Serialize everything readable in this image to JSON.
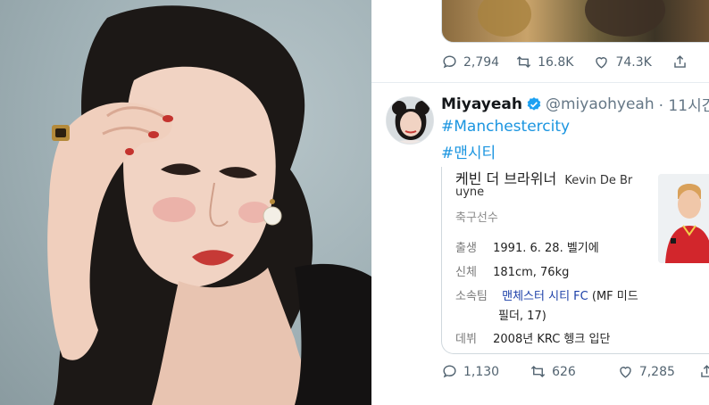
{
  "previous_tweet": {
    "replies": "2,794",
    "retweets": "16.8K",
    "likes": "74.3K"
  },
  "tweet": {
    "display_name": "Miyayeah",
    "handle": "@miyaohyeah",
    "time": "· 11시간",
    "hashtags": [
      "#Manchestercity",
      "#맨시티"
    ],
    "replies": "1,130",
    "retweets": "626",
    "likes": "7,285"
  },
  "card": {
    "name_korean": "케빈 더 브라위너",
    "name_latin_1": "Kevin De Br",
    "name_latin_2": "uyne",
    "subtitle": "축구선수",
    "rows": [
      {
        "key": "출생",
        "value": "1991. 6. 28. 벨기에"
      },
      {
        "key": "신체",
        "value": "181cm, 76kg"
      },
      {
        "key": "소속팀",
        "link": "맨체스터 시티 FC",
        "value": " (MF 미드"
      },
      {
        "key": "",
        "value": "필더, 17)"
      },
      {
        "key": "데뷔",
        "value": "2008년 KRC 헹크 입단"
      }
    ]
  },
  "colors": {
    "link_blue": "#1b95e0",
    "verified_blue": "#1da1f2",
    "meta_gray": "#536471",
    "card_link": "#1b3fa8"
  },
  "icons": [
    "reply-icon",
    "retweet-icon",
    "like-icon",
    "share-icon",
    "verified-icon"
  ]
}
